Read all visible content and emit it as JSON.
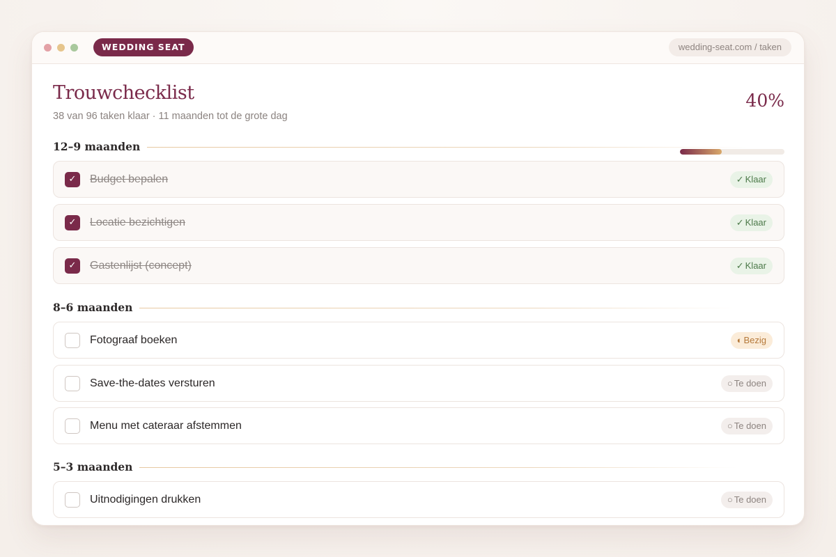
{
  "window": {
    "brand": "WEDDING SEAT",
    "url": "wedding-seat.com / taken"
  },
  "header": {
    "title": "Trouwchecklist",
    "subtitle": "38 van 96 taken klaar · 11 maanden tot de grote dag",
    "progress_label": "40%",
    "progress_value": 0.4
  },
  "sections": [
    {
      "title": "12–9 maanden",
      "tasks": [
        {
          "label": "Budget bepalen",
          "status": "Klaar",
          "status_icon": "✓",
          "done": true
        },
        {
          "label": "Locatie bezichtigen",
          "status": "Klaar",
          "status_icon": "✓",
          "done": true
        },
        {
          "label": "Gastenlijst (concept)",
          "status": "Klaar",
          "status_icon": "✓",
          "done": true
        }
      ]
    },
    {
      "title": "8–6 maanden",
      "tasks": [
        {
          "label": "Fotograaf boeken",
          "status": "Bezig",
          "status_icon": "◐",
          "done": false
        },
        {
          "label": "Save-the-dates versturen",
          "status": "Te doen",
          "status_icon": "○",
          "done": false
        },
        {
          "label": "Menu met cateraar afstemmen",
          "status": "Te doen",
          "status_icon": "○",
          "done": false
        }
      ]
    },
    {
      "title": "5–3 maanden",
      "tasks": [
        {
          "label": "Uitnodigingen drukken",
          "status": "Te doen",
          "status_icon": "○",
          "done": false
        }
      ]
    }
  ],
  "colors": {
    "accent": "#7a2a4a",
    "gold": "#d9a96b",
    "done_badge": "#4d7a4a",
    "busy_badge": "#b5793a",
    "todo_badge": "#8d8480"
  },
  "icons": {
    "checkbox_checked": "check-icon",
    "status_done": "check-icon",
    "status_busy": "half-circle-icon",
    "status_todo": "circle-icon"
  }
}
